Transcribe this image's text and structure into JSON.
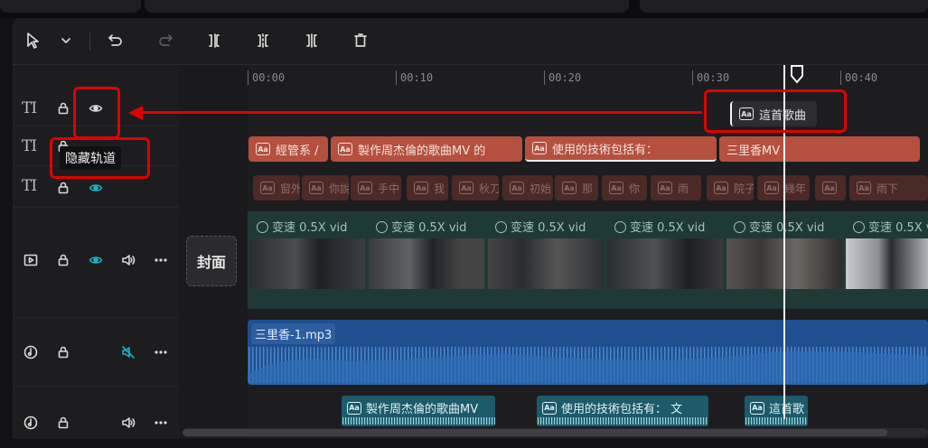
{
  "toolbar": {
    "tools": [
      "select-tool",
      "select-dropdown",
      "undo",
      "redo",
      "split-left",
      "split",
      "split-right",
      "delete"
    ]
  },
  "tracks": [
    {
      "type": "text",
      "icon_text": "TI",
      "locked": false,
      "visible": true
    },
    {
      "type": "text",
      "icon_text": "TI",
      "locked": false,
      "visible": true
    },
    {
      "type": "text",
      "icon_text": "TI",
      "locked": false,
      "visible": true
    },
    {
      "type": "video"
    },
    {
      "type": "audio"
    },
    {
      "type": "audio"
    }
  ],
  "tooltip": {
    "text": "隐藏轨道"
  },
  "cover": {
    "label": "封面"
  },
  "ruler": {
    "labels": [
      "00:00",
      "00:10",
      "00:20",
      "00:30",
      "00:40"
    ]
  },
  "clips": {
    "top_text": {
      "label": "這首歌曲"
    },
    "text_row": [
      {
        "label": "經管系 /"
      },
      {
        "label": "製作周杰倫的歌曲MV 的"
      },
      {
        "label": "使用的技術包括有："
      },
      {
        "label": "三里香MV"
      }
    ],
    "subtitle_row": [
      "窗外",
      "你說",
      "手中",
      "我",
      "秋刀",
      "初始",
      "那",
      "你",
      "雨",
      "院子",
      "幾年",
      "",
      "雨下"
    ],
    "video_label": "变速 0.5X  vid",
    "audio_label": "三里香-1.mp3",
    "tts": [
      {
        "label": "製作周杰倫的歌曲MV"
      },
      {
        "label": "使用的技術包括有：  文"
      },
      {
        "label": "這首歌"
      }
    ]
  },
  "badge_text": "Aa"
}
